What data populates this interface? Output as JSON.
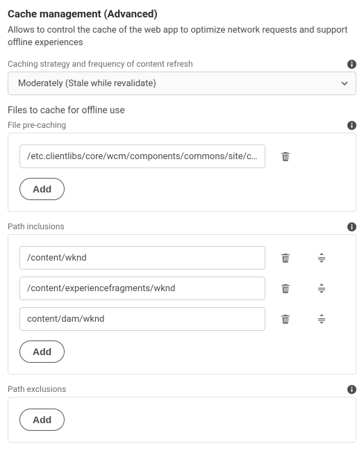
{
  "title": "Cache management (Advanced)",
  "description": "Allows to control the cache of the web app to optimize network requests and support offline experiences",
  "strategy": {
    "label": "Caching strategy and frequency of content refresh",
    "value": "Moderately (Stale while revalidate)"
  },
  "files_to_cache_heading": "Files to cache for offline use",
  "precache": {
    "label": "File pre-caching",
    "items": [
      {
        "value": "/etc.clientlibs/core/wcm/components/commons/site/cli…"
      }
    ],
    "add_label": "Add"
  },
  "inclusions": {
    "label": "Path inclusions",
    "items": [
      {
        "value": "/content/wknd"
      },
      {
        "value": "/content/experiencefragments/wknd"
      },
      {
        "value": "content/dam/wknd"
      }
    ],
    "add_label": "Add"
  },
  "exclusions": {
    "label": "Path exclusions",
    "items": [],
    "add_label": "Add"
  }
}
